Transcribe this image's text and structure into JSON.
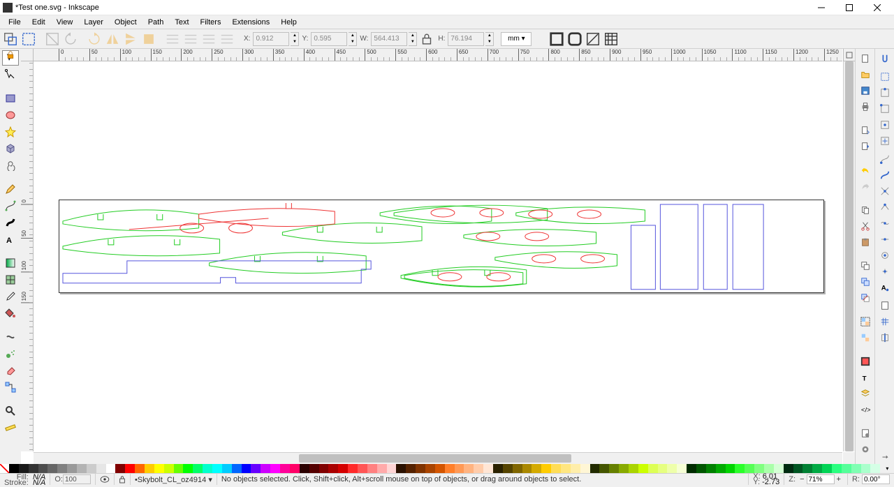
{
  "window": {
    "title": "*Test one.svg - Inkscape"
  },
  "menubar": [
    "File",
    "Edit",
    "View",
    "Layer",
    "Object",
    "Path",
    "Text",
    "Filters",
    "Extensions",
    "Help"
  ],
  "toolbar": {
    "x_label": "X:",
    "x_value": "0.912",
    "y_label": "Y:",
    "y_value": "0.595",
    "w_label": "W:",
    "w_value": "564.413",
    "h_label": "H:",
    "h_value": "76.194",
    "unit": "mm ▾"
  },
  "ruler_h": [
    "0",
    "50",
    "100",
    "150",
    "200",
    "250",
    "300",
    "350",
    "400",
    "450",
    "500",
    "550",
    "600",
    "650",
    "700",
    "750",
    "800",
    "850",
    "900",
    "950",
    "1000",
    "1050",
    "1100",
    "1150",
    "1200",
    "1250"
  ],
  "ruler_v": [
    "0",
    "50",
    "100",
    "150"
  ],
  "status": {
    "fill_label": "Fill:",
    "fill_value": "N/A",
    "stroke_label": "Stroke:",
    "stroke_value": "N/A",
    "opacity_label": "O:",
    "opacity_value": "100",
    "layer": "•Skybolt_CL_oz4914 ▾",
    "hint": "No objects selected. Click, Shift+click, Alt+scroll mouse on top of objects, or drag around objects to select.",
    "coord_x_label": "X:",
    "coord_x_value": "6.01",
    "coord_y_label": "Y:",
    "coord_y_value": "-2.73",
    "zoom_label": "Z:",
    "zoom_value": "71%",
    "rotate_label": "R:",
    "rotate_value": "0.00°"
  },
  "palette_colors": [
    "#000000",
    "#1a1a1a",
    "#333333",
    "#4d4d4d",
    "#666666",
    "#808080",
    "#999999",
    "#b3b3b3",
    "#cccccc",
    "#e6e6e6",
    "#ffffff",
    "#800000",
    "#ff0000",
    "#ff6600",
    "#ffcc00",
    "#ffff00",
    "#ccff00",
    "#66ff00",
    "#00ff00",
    "#00ff66",
    "#00ffcc",
    "#00ffff",
    "#00ccff",
    "#0066ff",
    "#0000ff",
    "#6600ff",
    "#cc00ff",
    "#ff00ff",
    "#ff0099",
    "#ff0066",
    "#2b0000",
    "#550000",
    "#800000",
    "#aa0000",
    "#d40000",
    "#ff2a2a",
    "#ff5555",
    "#ff8080",
    "#ffaaaa",
    "#ffd5d5",
    "#2b1100",
    "#552200",
    "#803300",
    "#aa4400",
    "#d45500",
    "#ff7f2a",
    "#ff9955",
    "#ffb380",
    "#ffccaa",
    "#ffe6d5",
    "#2b2200",
    "#554400",
    "#806600",
    "#aa8800",
    "#d4aa00",
    "#ffcc00",
    "#ffdd55",
    "#ffe680",
    "#ffeeaa",
    "#fff6d5",
    "#222b00",
    "#445500",
    "#668000",
    "#88aa00",
    "#aad400",
    "#ccff00",
    "#ddff55",
    "#e6ff80",
    "#eeffaa",
    "#f6ffd5",
    "#002b00",
    "#005500",
    "#008000",
    "#00aa00",
    "#00d400",
    "#2aff2a",
    "#55ff55",
    "#80ff80",
    "#aaffaa",
    "#d5ffd5",
    "#002b11",
    "#005522",
    "#008033",
    "#00aa44",
    "#00d455",
    "#2aff7f",
    "#55ff99",
    "#80ffb3",
    "#aaffcc",
    "#d5ffe6"
  ]
}
